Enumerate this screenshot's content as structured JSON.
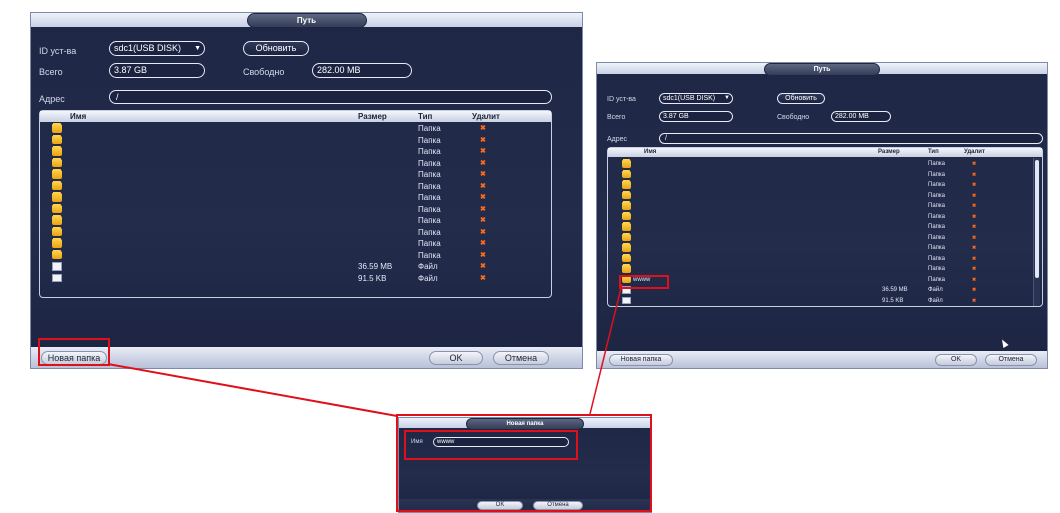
{
  "accent": "#e0101b",
  "dialog_left": {
    "title": "Путь",
    "device_label": "ID уст-ва",
    "device_value": "sdc1(USB DISK)",
    "refresh_label": "Обновить",
    "total_label": "Всего",
    "total_value": "3.87 GB",
    "free_label": "Свободно",
    "free_value": "282.00 MB",
    "address_label": "Адрес",
    "address_value": "/",
    "columns": {
      "name": "Имя",
      "size": "Размер",
      "type": "Тип",
      "delete": "Удалит"
    },
    "rows": [
      {
        "size": "",
        "type": "Папка"
      },
      {
        "size": "",
        "type": "Папка"
      },
      {
        "size": "",
        "type": "Папка"
      },
      {
        "size": "",
        "type": "Папка"
      },
      {
        "size": "",
        "type": "Папка"
      },
      {
        "size": "",
        "type": "Папка"
      },
      {
        "size": "",
        "type": "Папка"
      },
      {
        "size": "",
        "type": "Папка"
      },
      {
        "size": "",
        "type": "Папка"
      },
      {
        "size": "",
        "type": "Папка"
      },
      {
        "size": "",
        "type": "Папка"
      },
      {
        "size": "",
        "type": "Папка"
      },
      {
        "size": "36.59 MB",
        "type": "Файл"
      },
      {
        "size": "91.5 KB",
        "type": "Файл"
      }
    ],
    "new_folder_button": "Новая папка",
    "ok_button": "OK",
    "cancel_button": "Отмена"
  },
  "dialog_right": {
    "title": "Путь",
    "device_label": "ID уст-ва",
    "device_value": "sdc1(USB DISK)",
    "refresh_label": "Обновить",
    "total_label": "Всего",
    "total_value": "3.87 GB",
    "free_label": "Свободно",
    "free_value": "282.00 MB",
    "address_label": "Адрес",
    "address_value": "/",
    "columns": {
      "name": "Имя",
      "size": "Размер",
      "type": "Тип",
      "delete": "Удалит"
    },
    "rows": [
      {
        "name": "",
        "size": "",
        "type": "Папка"
      },
      {
        "name": "",
        "size": "",
        "type": "Папка"
      },
      {
        "name": "",
        "size": "",
        "type": "Папка"
      },
      {
        "name": "",
        "size": "",
        "type": "Папка"
      },
      {
        "name": "",
        "size": "",
        "type": "Папка"
      },
      {
        "name": "",
        "size": "",
        "type": "Папка"
      },
      {
        "name": "",
        "size": "",
        "type": "Папка"
      },
      {
        "name": "",
        "size": "",
        "type": "Папка"
      },
      {
        "name": "",
        "size": "",
        "type": "Папка"
      },
      {
        "name": "",
        "size": "",
        "type": "Папка"
      },
      {
        "name": "",
        "size": "",
        "type": "Папка"
      },
      {
        "name": "wwww",
        "size": "",
        "type": "Папка"
      },
      {
        "name": "",
        "size": "36.59 MB",
        "type": "Файл"
      },
      {
        "name": "",
        "size": "91.5 KB",
        "type": "Файл"
      }
    ],
    "new_folder_button": "Новая папка",
    "ok_button": "OK",
    "cancel_button": "Отмена"
  },
  "dialog_new_folder": {
    "title": "Новая папка",
    "name_label": "Имя",
    "name_value": "wwww",
    "ok_button": "OK",
    "cancel_button": "Отмена"
  }
}
